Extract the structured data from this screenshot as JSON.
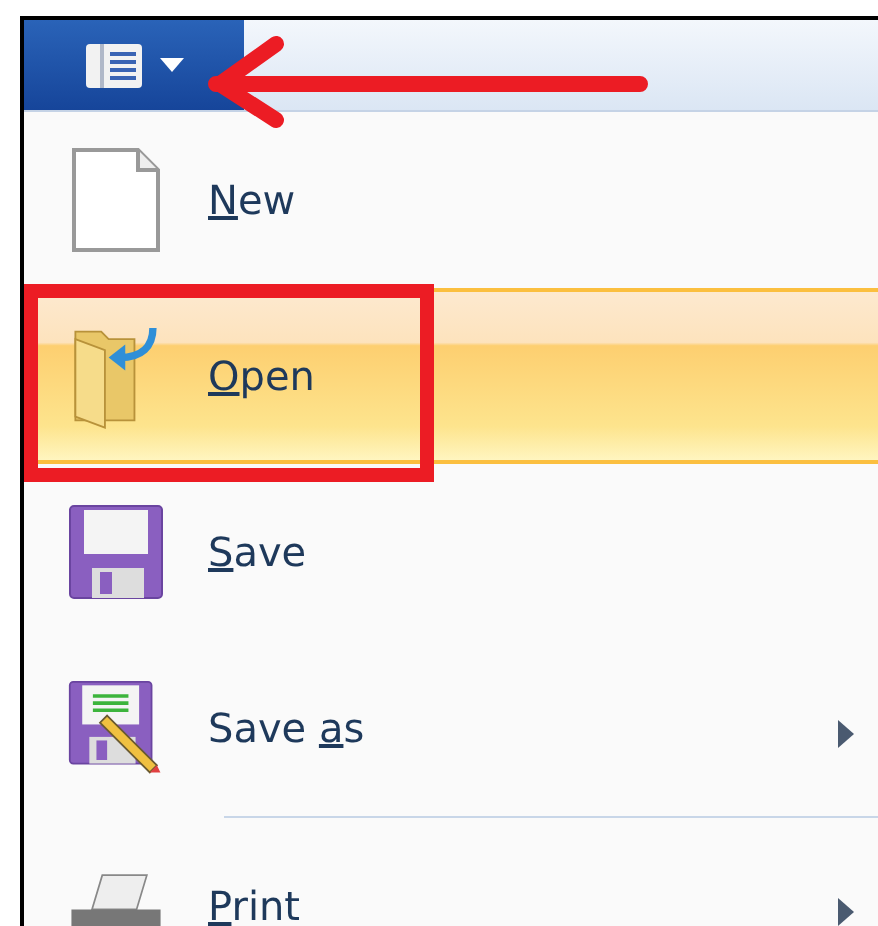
{
  "menu_button": {
    "expanded": true
  },
  "items": [
    {
      "kind": "new",
      "key": "N",
      "rest": "ew",
      "selected": false,
      "submenu": false
    },
    {
      "kind": "open",
      "key": "O",
      "rest": "pen",
      "selected": true,
      "submenu": false
    },
    {
      "kind": "save",
      "key": "S",
      "rest": "ave",
      "selected": false,
      "submenu": false
    },
    {
      "kind": "saveas",
      "pre": "Save ",
      "key": "a",
      "rest": "s",
      "selected": false,
      "submenu": true,
      "separator_after": true
    },
    {
      "kind": "print",
      "key": "P",
      "rest": "rint",
      "selected": false,
      "submenu": true
    }
  ]
}
